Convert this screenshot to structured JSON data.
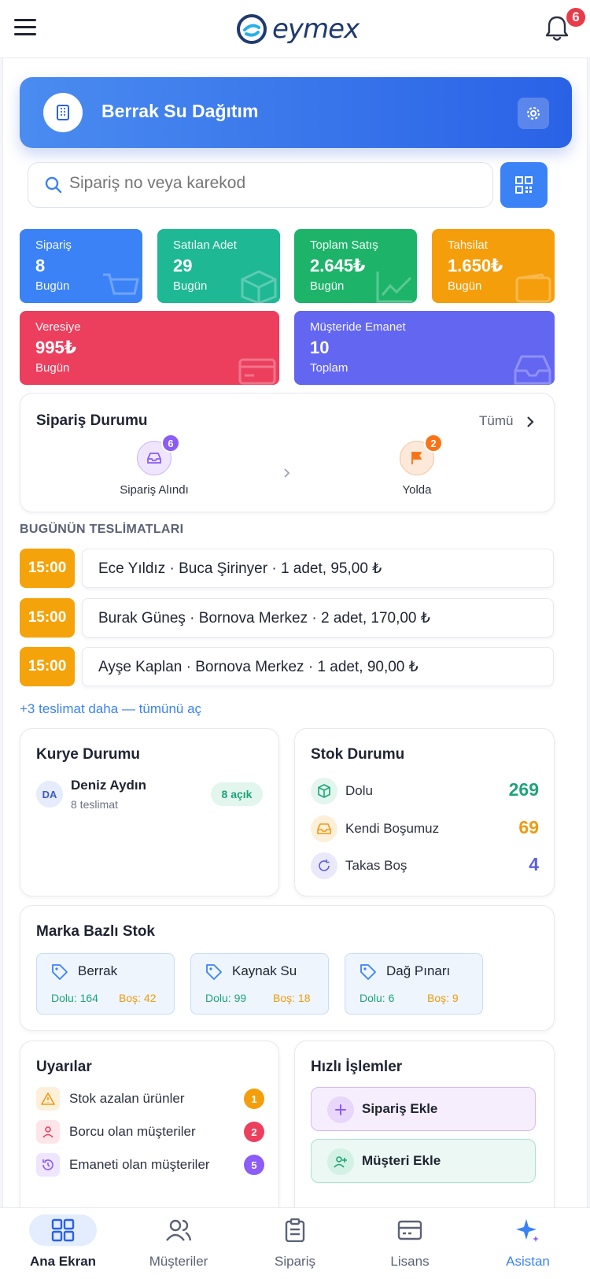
{
  "app": {
    "logo_text": "eymex",
    "notification_count": "6"
  },
  "header": {
    "company_name": "Berrak Su Dağıtım"
  },
  "search": {
    "placeholder": "Sipariş no veya karekod"
  },
  "stats": [
    {
      "label": "Sipariş",
      "value": "8",
      "sub": "Bugün",
      "color": "#3b82f6",
      "icon": "cart-icon"
    },
    {
      "label": "Satılan Adet",
      "value": "29",
      "sub": "Bugün",
      "color": "#1fb894",
      "icon": "box-icon"
    },
    {
      "label": "Toplam Satış",
      "value": "2.645₺",
      "sub": "Bugün",
      "color": "#1db46a",
      "icon": "trend-icon"
    },
    {
      "label": "Tahsilat",
      "value": "1.650₺",
      "sub": "Bugün",
      "color": "#f59e0b",
      "icon": "wallet-icon"
    },
    {
      "label": "Veresiye",
      "value": "995₺",
      "sub": "Bugün",
      "color": "#ec3f5e",
      "icon": "card-icon"
    },
    {
      "label": "Müşteride Emanet",
      "value": "10",
      "sub": "Toplam",
      "color": "#6366f1",
      "icon": "inbox-icon"
    }
  ],
  "order_status": {
    "title": "Sipariş Durumu",
    "all_label": "Tümü",
    "steps": [
      {
        "label": "Sipariş Alındı",
        "count": "6",
        "color": "#8b5cf6",
        "icon": "inbox-icon"
      },
      {
        "label": "Yolda",
        "count": "2",
        "color": "#f97316",
        "icon": "flag-icon"
      }
    ]
  },
  "deliveries": {
    "title": "BUGÜNÜN TESLİMATLARI",
    "items": [
      {
        "time": "15:00",
        "text": "Ece Yıldız · Buca Şirinyer · 1 adet, 95,00 ₺"
      },
      {
        "time": "15:00",
        "text": "Burak Güneş · Bornova Merkez · 2 adet, 170,00 ₺"
      },
      {
        "time": "15:00",
        "text": "Ayşe Kaplan · Bornova Merkez · 1 adet, 90,00 ₺"
      }
    ],
    "more_link": "+3 teslimat daha — tümünü aç"
  },
  "courier": {
    "title": "Kurye Durumu",
    "initials": "DA",
    "name": "Deniz Aydın",
    "deliveries": "8 teslimat",
    "open_badge": "8 açık"
  },
  "stock": {
    "title": "Stok Durumu",
    "rows": [
      {
        "name": "Dolu",
        "value": "269",
        "color": "#1fa37a",
        "icon": "cube-icon"
      },
      {
        "name": "Kendi Boşumuz",
        "value": "69",
        "color": "#f09a10",
        "icon": "inbox-icon"
      },
      {
        "name": "Takas Boş",
        "value": "4",
        "color": "#5b5fe0",
        "icon": "refresh-icon"
      }
    ]
  },
  "brand_stock": {
    "title": "Marka Bazlı Stok",
    "brands": [
      {
        "name": "Berrak",
        "full": "Dolu: 164",
        "empty": "Boş: 42"
      },
      {
        "name": "Kaynak Su",
        "full": "Dolu: 99",
        "empty": "Boş: 18"
      },
      {
        "name": "Dağ Pınarı",
        "full": "Dolu: 6",
        "empty": "Boş: 9"
      }
    ]
  },
  "warnings": {
    "title": "Uyarılar",
    "items": [
      {
        "text": "Stok azalan ürünler",
        "count": "1",
        "color": "#f59e0b",
        "icon": "warning-icon"
      },
      {
        "text": "Borcu olan müşteriler",
        "count": "2",
        "color": "#ec3f5e",
        "icon": "user-icon"
      },
      {
        "text": "Emaneti olan müşteriler",
        "count": "5",
        "color": "#8b5cf6",
        "icon": "history-icon"
      }
    ]
  },
  "quick_actions": {
    "title": "Hızlı İşlemler",
    "items": [
      {
        "label": "Sipariş Ekle",
        "icon": "plus-icon"
      },
      {
        "label": "Müşteri Ekle",
        "icon": "user-plus-icon"
      }
    ]
  },
  "bottom_nav": [
    {
      "label": "Ana Ekran",
      "icon": "grid-icon",
      "active": true
    },
    {
      "label": "Müşteriler",
      "icon": "users-icon",
      "active": false
    },
    {
      "label": "Sipariş",
      "icon": "clipboard-icon",
      "active": false
    },
    {
      "label": "Lisans",
      "icon": "license-card-icon",
      "active": false
    },
    {
      "label": "Asistan",
      "icon": "sparkle-icon",
      "active": false
    }
  ]
}
